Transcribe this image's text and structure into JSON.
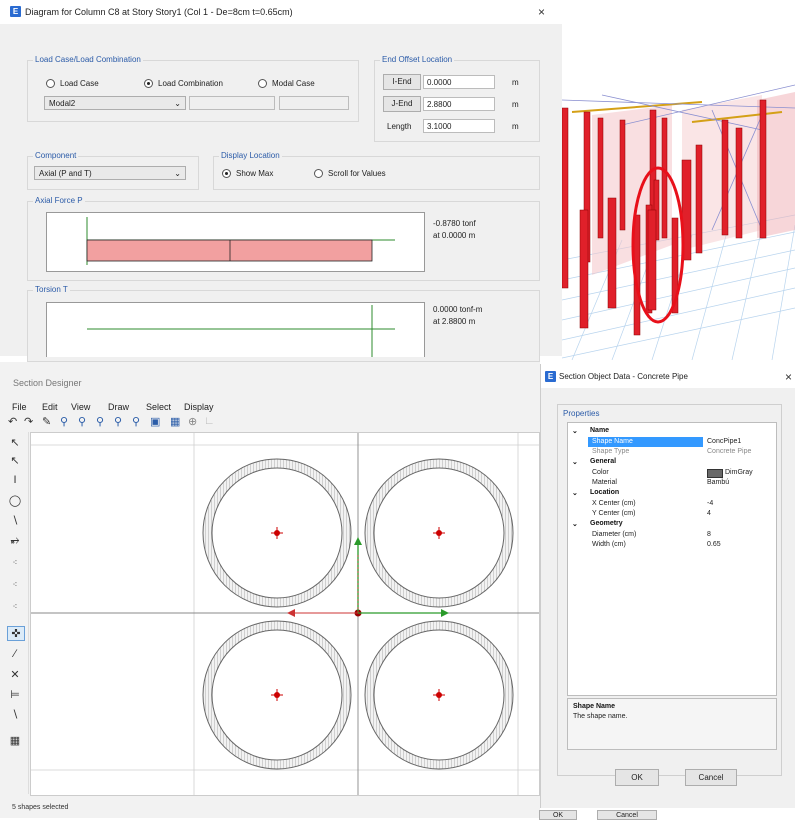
{
  "diagram_window": {
    "title": "Diagram for Column C8 at Story Story1 (Col 1 - De=8cm t=0.65cm)",
    "close_glyph": "×",
    "load_case_group": {
      "label": "Load Case/Load Combination",
      "options": [
        "Load Case",
        "Load Combination",
        "Modal Case"
      ],
      "selected": "Load Combination",
      "combo_value": "Modal2"
    },
    "end_offset_group": {
      "label": "End Offset Location",
      "i_end_label": "I-End",
      "i_end_value": "0.0000",
      "j_end_label": "J-End",
      "j_end_value": "2.8800",
      "length_label": "Length",
      "length_value": "3.1000",
      "unit": "m"
    },
    "component_group": {
      "label": "Component",
      "value": "Axial (P and T)"
    },
    "display_location_group": {
      "label": "Display Location",
      "options": [
        "Show Max",
        "Scroll for Values"
      ],
      "selected": "Show Max"
    },
    "axial_group": {
      "label": "Axial Force P",
      "max_value": "-0.8780 tonf",
      "max_location": "at 0.0000 m",
      "fill_color": "#f2a0a0"
    },
    "torsion_group": {
      "label": "Torsion T",
      "max_value": "0.0000 tonf-m",
      "max_location": "at 2.8800 m"
    }
  },
  "section_designer": {
    "title": "Section Designer",
    "menu": [
      "File",
      "Edit",
      "View",
      "Draw",
      "Select",
      "Display"
    ],
    "status": "5 shapes selected",
    "shape_fill": "#cfcfcf",
    "center_color": "#cc0000"
  },
  "section_object_data": {
    "title": "Section Object Data - Concrete Pipe",
    "close_glyph": "×",
    "properties_label": "Properties",
    "categories": [
      {
        "name": "Name",
        "rows": [
          [
            "Shape Name",
            "ConcPipe1"
          ],
          [
            "Shape Type",
            "Concrete Pipe"
          ]
        ]
      },
      {
        "name": "General",
        "rows": [
          [
            "Color",
            "DimGray"
          ],
          [
            "Material",
            "Bambú"
          ]
        ]
      },
      {
        "name": "Location",
        "rows": [
          [
            "X Center (cm)",
            "-4"
          ],
          [
            "Y Center (cm)",
            "4"
          ]
        ]
      },
      {
        "name": "Geometry",
        "rows": [
          [
            "Diameter (cm)",
            "8"
          ],
          [
            "Width (cm)",
            "0.65"
          ]
        ]
      }
    ],
    "help_title": "Shape Name",
    "help_text": "The shape name.",
    "ok_label": "OK",
    "cancel_label": "Cancel",
    "selected_row_color": "#3399ff",
    "swatch_color": "#696969"
  },
  "background_buttons": {
    "ok_label": "OK",
    "cancel_label": "Cancel"
  }
}
